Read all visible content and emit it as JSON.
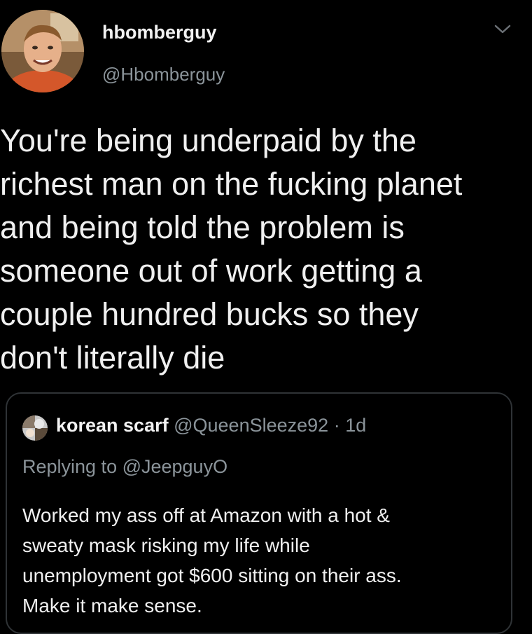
{
  "tweet": {
    "display_name": "hbomberguy",
    "handle": "@Hbomberguy",
    "more_icon": "chevron-down-icon",
    "text": "You're being underpaid by the\nrichest man on the fucking planet\nand being told the problem is\nsomeone out of work getting a\ncouple hundred bucks so they\ndon't literally die"
  },
  "quoted_tweet": {
    "display_name": "korean scarf",
    "handle": "@QueenSleeze92",
    "separator": "·",
    "time": "1d",
    "replying_to": "Replying to @JeepguyO",
    "text": "Worked my ass off at Amazon with a hot &\nsweaty mask risking my life while\nunemployment got $600 sitting on their ass.\nMake it make sense."
  },
  "colors": {
    "background": "#000000",
    "primary_text": "#f0f0f0",
    "secondary_text": "#8b949a",
    "card_border": "#2f3336"
  }
}
